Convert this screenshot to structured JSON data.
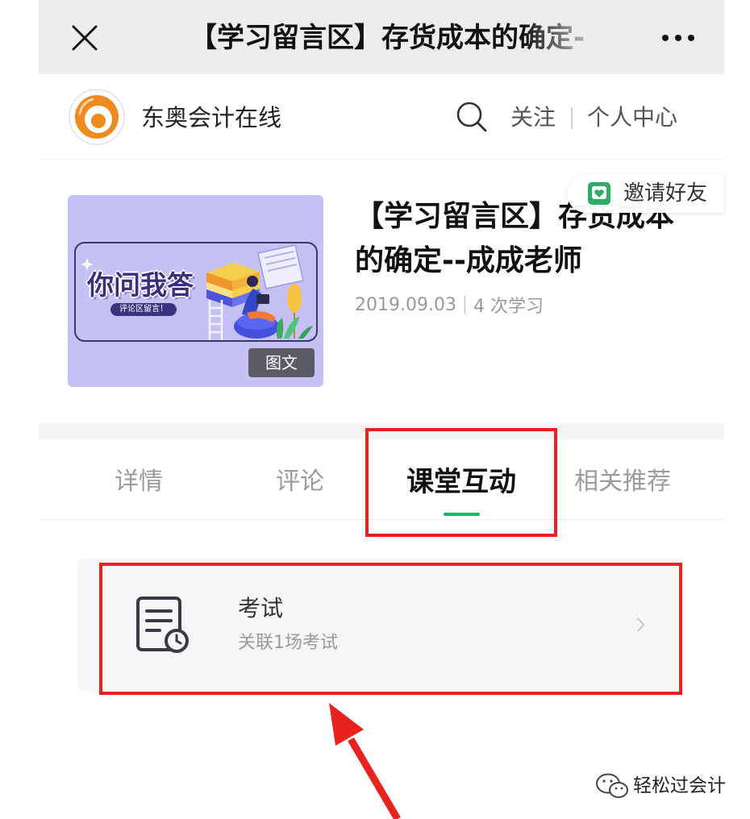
{
  "topbar": {
    "close_icon": "close-icon",
    "title": "【学习留言区】存货成本的确定-",
    "more_icon": "more-icon"
  },
  "header": {
    "logo_icon": "dongao-logo-icon",
    "brand_name": "东奥会计在线",
    "search_icon": "search-icon",
    "follow_label": "关注",
    "personal_center_label": "个人中心"
  },
  "invite": {
    "icon": "invite-heart-icon",
    "label": "邀请好友"
  },
  "course": {
    "thumbnail": {
      "headline": "你问我答",
      "subline": "评论区留言！",
      "type_label": "图文"
    },
    "title": "【学习留言区】存货成本的确定--成成老师",
    "date": "2019.09.03",
    "study_count": "4 次学习"
  },
  "tabs": [
    {
      "label": "详情",
      "active": false
    },
    {
      "label": "评论",
      "active": false
    },
    {
      "label": "课堂互动",
      "active": true
    },
    {
      "label": "相关推荐",
      "active": false
    }
  ],
  "interaction": {
    "items": [
      {
        "icon": "exam-icon",
        "title": "考试",
        "subtitle": "关联1场考试",
        "chevron_icon": "chevron-right-icon"
      }
    ]
  },
  "watermark": {
    "icon": "wechat-icon",
    "text": "轻松过会计"
  },
  "colors": {
    "accent_green": "#07c160",
    "annotation_red": "#e8231e",
    "topbar_bg": "#ededed",
    "brand_orange": "#ef8a1e",
    "thumbnail_bg": "#c6c1f5",
    "type_badge_bg": "#5c5a66"
  }
}
